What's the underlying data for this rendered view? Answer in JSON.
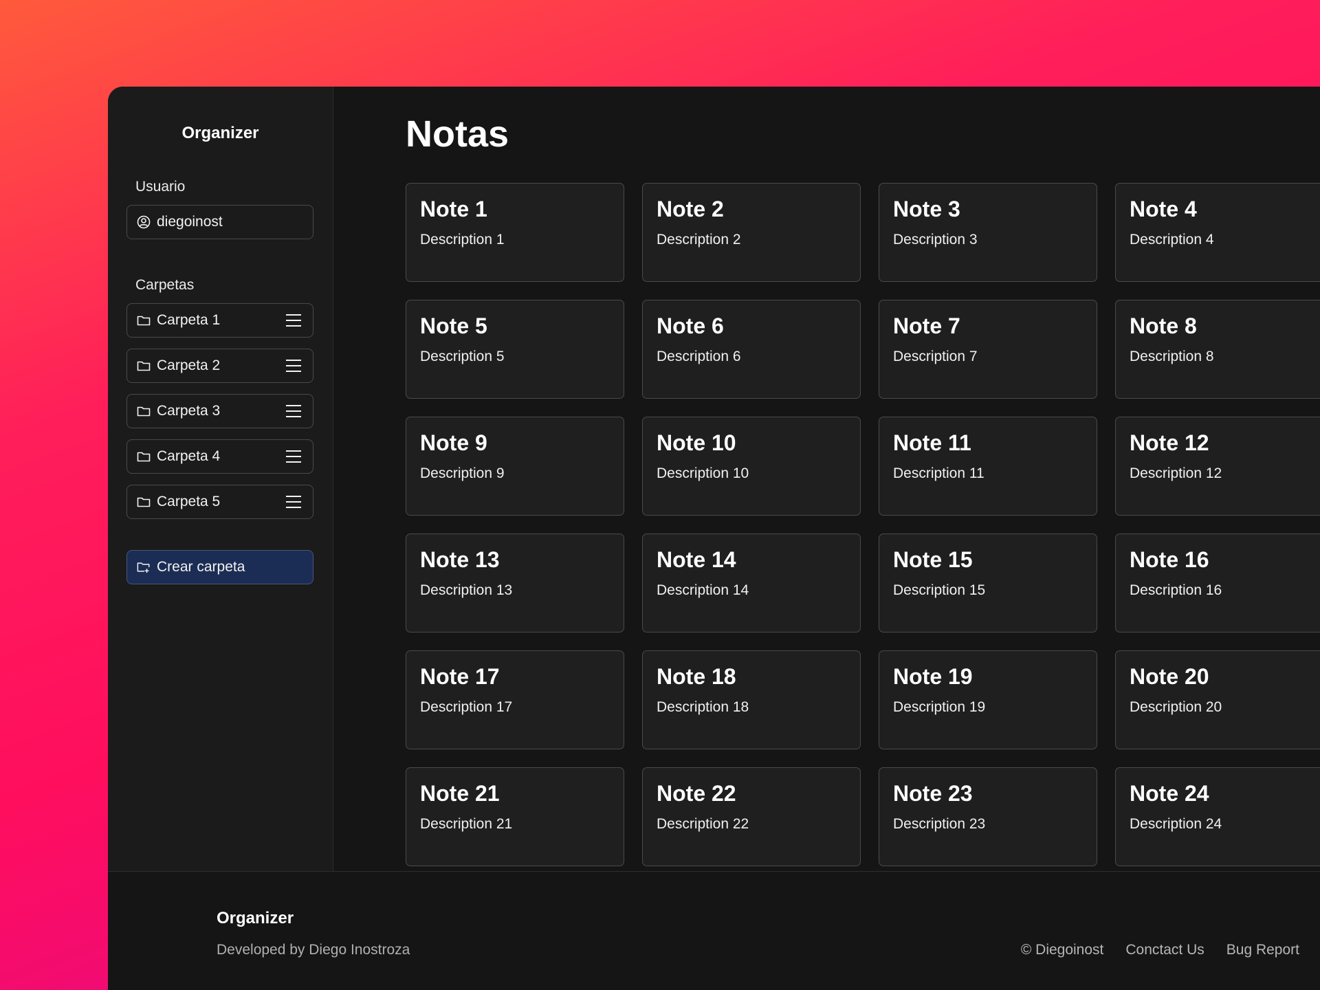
{
  "sidebar": {
    "app_title": "Organizer",
    "user_label": "Usuario",
    "username": "diegoinost",
    "folders_label": "Carpetas",
    "folders": [
      {
        "label": "Carpeta 1"
      },
      {
        "label": "Carpeta 2"
      },
      {
        "label": "Carpeta 3"
      },
      {
        "label": "Carpeta 4"
      },
      {
        "label": "Carpeta 5"
      }
    ],
    "create_folder_label": "Crear carpeta"
  },
  "main": {
    "title": "Notas",
    "notes": [
      {
        "title": "Note 1",
        "description": "Description 1"
      },
      {
        "title": "Note 2",
        "description": "Description 2"
      },
      {
        "title": "Note 3",
        "description": "Description 3"
      },
      {
        "title": "Note 4",
        "description": "Description 4"
      },
      {
        "title": "Note 5",
        "description": "Description 5"
      },
      {
        "title": "Note 6",
        "description": "Description 6"
      },
      {
        "title": "Note 7",
        "description": "Description 7"
      },
      {
        "title": "Note 8",
        "description": "Description 8"
      },
      {
        "title": "Note 9",
        "description": "Description 9"
      },
      {
        "title": "Note 10",
        "description": "Description 10"
      },
      {
        "title": "Note 11",
        "description": "Description 11"
      },
      {
        "title": "Note 12",
        "description": "Description 12"
      },
      {
        "title": "Note 13",
        "description": "Description 13"
      },
      {
        "title": "Note 14",
        "description": "Description 14"
      },
      {
        "title": "Note 15",
        "description": "Description 15"
      },
      {
        "title": "Note 16",
        "description": "Description 16"
      },
      {
        "title": "Note 17",
        "description": "Description 17"
      },
      {
        "title": "Note 18",
        "description": "Description 18"
      },
      {
        "title": "Note 19",
        "description": "Description 19"
      },
      {
        "title": "Note 20",
        "description": "Description 20"
      },
      {
        "title": "Note 21",
        "description": "Description 21"
      },
      {
        "title": "Note 22",
        "description": "Description 22"
      },
      {
        "title": "Note 23",
        "description": "Description 23"
      },
      {
        "title": "Note 24",
        "description": "Description 24"
      }
    ]
  },
  "footer": {
    "title": "Organizer",
    "subtitle": "Developed by Diego Inostroza",
    "copyright": "© Diegoinost",
    "contact": "Conctact Us",
    "bug_report": "Bug Report"
  },
  "icons": {
    "user": "user-circle-icon",
    "folder": "folder-icon",
    "menu": "menu-icon",
    "folder_plus": "folder-plus-icon"
  },
  "colors": {
    "create_button_bg": "#1c2d55",
    "window_bg": "#151515",
    "card_bg": "#1f1f1f"
  }
}
